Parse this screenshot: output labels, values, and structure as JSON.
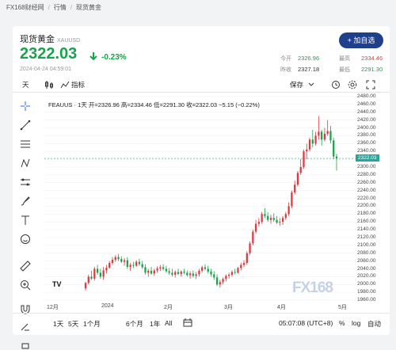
{
  "breadcrumb": {
    "site": "FX168财经网",
    "section": "行情",
    "page": "现货黄金"
  },
  "header": {
    "name": "现货黄金",
    "symbol": "XAUUSD",
    "follow_label": "+ 加自选",
    "price": "2322.03",
    "change_pct": "-0.23%",
    "time": "2024-04-24 04:59:01",
    "stats": {
      "open_label": "今开",
      "open": "2326.96",
      "prev_label": "昨收",
      "prev": "2327.18",
      "high_label": "最高",
      "high": "2334.46",
      "low_label": "最低",
      "low": "2291.30"
    }
  },
  "toolbar": {
    "interval": "天",
    "indicators": "指标",
    "save": "保存"
  },
  "legend": {
    "text": "FEAUUS · 1天   开=2326.96 高=2334.46 低=2291.30 收=2322.03 −5.15 (−0.22%)"
  },
  "bottom": {
    "ranges": [
      "1天",
      "5天",
      "1个月",
      "6个月",
      "1年",
      "All"
    ],
    "clock": "05:07:08 (UTC+8)",
    "pct": "%",
    "log": "log",
    "auto": "自动"
  },
  "watermark": "FX168",
  "tv_logo": "TV",
  "colors": {
    "up": "#e0383e",
    "down": "#17a34a",
    "accent": "#1f3f8c"
  },
  "chart_data": {
    "type": "candlestick",
    "ylim": [
      1950,
      2490
    ],
    "y_ticks": [
      2480,
      2460,
      2440,
      2420,
      2400,
      2380,
      2360,
      2340,
      2320,
      2300,
      2280,
      2260,
      2240,
      2220,
      2200,
      2180,
      2160,
      2140,
      2120,
      2100,
      2080,
      2060,
      2040,
      2020,
      2000,
      1980,
      1960
    ],
    "last_price_label": "2322.03",
    "x_ticks": [
      "12月",
      "2024",
      "2月",
      "3月",
      "4月",
      "5月"
    ],
    "candles": [
      [
        1990,
        2007,
        1985,
        2004
      ],
      [
        2004,
        2025,
        2000,
        2020
      ],
      [
        2020,
        2035,
        2012,
        2015
      ],
      [
        2015,
        2045,
        2010,
        2040
      ],
      [
        2040,
        2050,
        2025,
        2030
      ],
      [
        2030,
        2040,
        2015,
        2020
      ],
      [
        2020,
        2045,
        2012,
        2036
      ],
      [
        2036,
        2050,
        2028,
        2043
      ],
      [
        2043,
        2060,
        2040,
        2055
      ],
      [
        2055,
        2070,
        2050,
        2063
      ],
      [
        2063,
        2075,
        2058,
        2070
      ],
      [
        2070,
        2078,
        2060,
        2065
      ],
      [
        2065,
        2072,
        2055,
        2058
      ],
      [
        2058,
        2068,
        2048,
        2062
      ],
      [
        2062,
        2070,
        2040,
        2045
      ],
      [
        2045,
        2055,
        2035,
        2050
      ],
      [
        2050,
        2058,
        2042,
        2048
      ],
      [
        2048,
        2062,
        2045,
        2058
      ],
      [
        2058,
        2066,
        2048,
        2052
      ],
      [
        2052,
        2060,
        2040,
        2044
      ],
      [
        2044,
        2052,
        2025,
        2030
      ],
      [
        2030,
        2040,
        2020,
        2035
      ],
      [
        2035,
        2045,
        2025,
        2028
      ],
      [
        2028,
        2040,
        2022,
        2036
      ],
      [
        2036,
        2046,
        2030,
        2041
      ],
      [
        2041,
        2050,
        2035,
        2044
      ],
      [
        2044,
        2052,
        2036,
        2040
      ],
      [
        2040,
        2048,
        2030,
        2034
      ],
      [
        2034,
        2042,
        2025,
        2030
      ],
      [
        2030,
        2040,
        2020,
        2025
      ],
      [
        2025,
        2036,
        2018,
        2032
      ],
      [
        2032,
        2040,
        2024,
        2027
      ],
      [
        2027,
        2036,
        2020,
        2033
      ],
      [
        2033,
        2040,
        2026,
        2030
      ],
      [
        2030,
        2036,
        2020,
        2024
      ],
      [
        2024,
        2034,
        2015,
        2028
      ],
      [
        2028,
        2036,
        2018,
        2022
      ],
      [
        2022,
        2032,
        2014,
        2026
      ],
      [
        2026,
        2040,
        2020,
        2035
      ],
      [
        2035,
        2048,
        2030,
        2044
      ],
      [
        2044,
        2052,
        2036,
        2040
      ],
      [
        2040,
        2048,
        2028,
        2033
      ],
      [
        2033,
        2040,
        2020,
        2026
      ],
      [
        2026,
        2034,
        2012,
        2018
      ],
      [
        2018,
        2026,
        1996,
        2000
      ],
      [
        2000,
        2012,
        1992,
        2006
      ],
      [
        2006,
        2018,
        2000,
        2014
      ],
      [
        2014,
        2026,
        2008,
        2022
      ],
      [
        2022,
        2030,
        2015,
        2025
      ],
      [
        2025,
        2036,
        2020,
        2032
      ],
      [
        2032,
        2040,
        2026,
        2030
      ],
      [
        2030,
        2045,
        2028,
        2042
      ],
      [
        2042,
        2056,
        2036,
        2050
      ],
      [
        2050,
        2062,
        2044,
        2055
      ],
      [
        2055,
        2085,
        2050,
        2080
      ],
      [
        2080,
        2110,
        2075,
        2105
      ],
      [
        2105,
        2140,
        2100,
        2135
      ],
      [
        2135,
        2165,
        2130,
        2155
      ],
      [
        2155,
        2170,
        2148,
        2160
      ],
      [
        2160,
        2185,
        2155,
        2180
      ],
      [
        2180,
        2195,
        2170,
        2175
      ],
      [
        2175,
        2185,
        2160,
        2165
      ],
      [
        2165,
        2178,
        2155,
        2170
      ],
      [
        2170,
        2182,
        2160,
        2165
      ],
      [
        2165,
        2175,
        2155,
        2158
      ],
      [
        2158,
        2170,
        2150,
        2160
      ],
      [
        2160,
        2175,
        2152,
        2170
      ],
      [
        2170,
        2185,
        2165,
        2180
      ],
      [
        2180,
        2210,
        2175,
        2200
      ],
      [
        2200,
        2240,
        2195,
        2235
      ],
      [
        2235,
        2265,
        2230,
        2255
      ],
      [
        2255,
        2290,
        2250,
        2285
      ],
      [
        2285,
        2320,
        2280,
        2300
      ],
      [
        2300,
        2345,
        2295,
        2340
      ],
      [
        2340,
        2360,
        2320,
        2345
      ],
      [
        2345,
        2375,
        2340,
        2370
      ],
      [
        2370,
        2395,
        2350,
        2360
      ],
      [
        2360,
        2390,
        2355,
        2380
      ],
      [
        2380,
        2430,
        2370,
        2390
      ],
      [
        2390,
        2395,
        2355,
        2370
      ],
      [
        2370,
        2400,
        2365,
        2385
      ],
      [
        2385,
        2420,
        2380,
        2392
      ],
      [
        2392,
        2405,
        2360,
        2368
      ],
      [
        2368,
        2375,
        2320,
        2327
      ],
      [
        2327,
        2334,
        2291,
        2322
      ]
    ]
  }
}
